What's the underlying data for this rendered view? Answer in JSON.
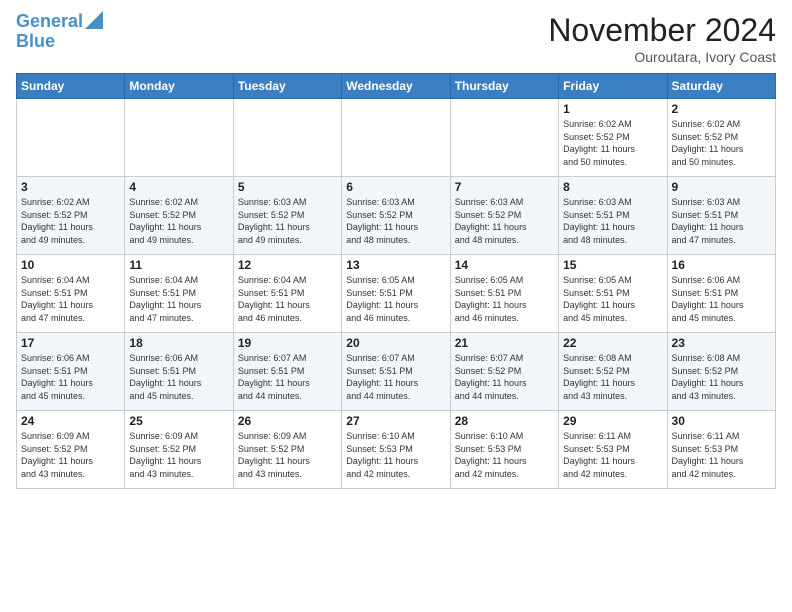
{
  "header": {
    "logo_line1": "General",
    "logo_line2": "Blue",
    "month": "November 2024",
    "location": "Ouroutara, Ivory Coast"
  },
  "weekdays": [
    "Sunday",
    "Monday",
    "Tuesday",
    "Wednesday",
    "Thursday",
    "Friday",
    "Saturday"
  ],
  "weeks": [
    [
      {
        "day": "",
        "info": ""
      },
      {
        "day": "",
        "info": ""
      },
      {
        "day": "",
        "info": ""
      },
      {
        "day": "",
        "info": ""
      },
      {
        "day": "",
        "info": ""
      },
      {
        "day": "1",
        "info": "Sunrise: 6:02 AM\nSunset: 5:52 PM\nDaylight: 11 hours\nand 50 minutes."
      },
      {
        "day": "2",
        "info": "Sunrise: 6:02 AM\nSunset: 5:52 PM\nDaylight: 11 hours\nand 50 minutes."
      }
    ],
    [
      {
        "day": "3",
        "info": "Sunrise: 6:02 AM\nSunset: 5:52 PM\nDaylight: 11 hours\nand 49 minutes."
      },
      {
        "day": "4",
        "info": "Sunrise: 6:02 AM\nSunset: 5:52 PM\nDaylight: 11 hours\nand 49 minutes."
      },
      {
        "day": "5",
        "info": "Sunrise: 6:03 AM\nSunset: 5:52 PM\nDaylight: 11 hours\nand 49 minutes."
      },
      {
        "day": "6",
        "info": "Sunrise: 6:03 AM\nSunset: 5:52 PM\nDaylight: 11 hours\nand 48 minutes."
      },
      {
        "day": "7",
        "info": "Sunrise: 6:03 AM\nSunset: 5:52 PM\nDaylight: 11 hours\nand 48 minutes."
      },
      {
        "day": "8",
        "info": "Sunrise: 6:03 AM\nSunset: 5:51 PM\nDaylight: 11 hours\nand 48 minutes."
      },
      {
        "day": "9",
        "info": "Sunrise: 6:03 AM\nSunset: 5:51 PM\nDaylight: 11 hours\nand 47 minutes."
      }
    ],
    [
      {
        "day": "10",
        "info": "Sunrise: 6:04 AM\nSunset: 5:51 PM\nDaylight: 11 hours\nand 47 minutes."
      },
      {
        "day": "11",
        "info": "Sunrise: 6:04 AM\nSunset: 5:51 PM\nDaylight: 11 hours\nand 47 minutes."
      },
      {
        "day": "12",
        "info": "Sunrise: 6:04 AM\nSunset: 5:51 PM\nDaylight: 11 hours\nand 46 minutes."
      },
      {
        "day": "13",
        "info": "Sunrise: 6:05 AM\nSunset: 5:51 PM\nDaylight: 11 hours\nand 46 minutes."
      },
      {
        "day": "14",
        "info": "Sunrise: 6:05 AM\nSunset: 5:51 PM\nDaylight: 11 hours\nand 46 minutes."
      },
      {
        "day": "15",
        "info": "Sunrise: 6:05 AM\nSunset: 5:51 PM\nDaylight: 11 hours\nand 45 minutes."
      },
      {
        "day": "16",
        "info": "Sunrise: 6:06 AM\nSunset: 5:51 PM\nDaylight: 11 hours\nand 45 minutes."
      }
    ],
    [
      {
        "day": "17",
        "info": "Sunrise: 6:06 AM\nSunset: 5:51 PM\nDaylight: 11 hours\nand 45 minutes."
      },
      {
        "day": "18",
        "info": "Sunrise: 6:06 AM\nSunset: 5:51 PM\nDaylight: 11 hours\nand 45 minutes."
      },
      {
        "day": "19",
        "info": "Sunrise: 6:07 AM\nSunset: 5:51 PM\nDaylight: 11 hours\nand 44 minutes."
      },
      {
        "day": "20",
        "info": "Sunrise: 6:07 AM\nSunset: 5:51 PM\nDaylight: 11 hours\nand 44 minutes."
      },
      {
        "day": "21",
        "info": "Sunrise: 6:07 AM\nSunset: 5:52 PM\nDaylight: 11 hours\nand 44 minutes."
      },
      {
        "day": "22",
        "info": "Sunrise: 6:08 AM\nSunset: 5:52 PM\nDaylight: 11 hours\nand 43 minutes."
      },
      {
        "day": "23",
        "info": "Sunrise: 6:08 AM\nSunset: 5:52 PM\nDaylight: 11 hours\nand 43 minutes."
      }
    ],
    [
      {
        "day": "24",
        "info": "Sunrise: 6:09 AM\nSunset: 5:52 PM\nDaylight: 11 hours\nand 43 minutes."
      },
      {
        "day": "25",
        "info": "Sunrise: 6:09 AM\nSunset: 5:52 PM\nDaylight: 11 hours\nand 43 minutes."
      },
      {
        "day": "26",
        "info": "Sunrise: 6:09 AM\nSunset: 5:52 PM\nDaylight: 11 hours\nand 43 minutes."
      },
      {
        "day": "27",
        "info": "Sunrise: 6:10 AM\nSunset: 5:53 PM\nDaylight: 11 hours\nand 42 minutes."
      },
      {
        "day": "28",
        "info": "Sunrise: 6:10 AM\nSunset: 5:53 PM\nDaylight: 11 hours\nand 42 minutes."
      },
      {
        "day": "29",
        "info": "Sunrise: 6:11 AM\nSunset: 5:53 PM\nDaylight: 11 hours\nand 42 minutes."
      },
      {
        "day": "30",
        "info": "Sunrise: 6:11 AM\nSunset: 5:53 PM\nDaylight: 11 hours\nand 42 minutes."
      }
    ]
  ]
}
